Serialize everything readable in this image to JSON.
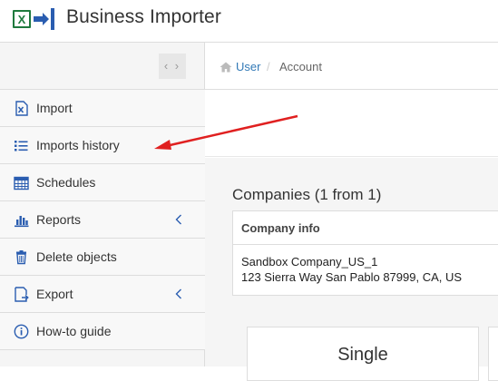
{
  "app": {
    "title": "Business Importer",
    "logo_icon": "excel-import-logo-icon"
  },
  "sidebar": {
    "collapse_toggle": "‹ ›",
    "items": [
      {
        "label": "Import",
        "icon": "excel-file-icon",
        "has_chevron": false
      },
      {
        "label": "Imports history",
        "icon": "list-icon",
        "has_chevron": false
      },
      {
        "label": "Schedules",
        "icon": "calendar-icon",
        "has_chevron": false
      },
      {
        "label": "Reports",
        "icon": "bar-chart-icon",
        "has_chevron": true
      },
      {
        "label": "Delete objects",
        "icon": "trash-icon",
        "has_chevron": false
      },
      {
        "label": "Export",
        "icon": "export-icon",
        "has_chevron": true
      },
      {
        "label": "How-to guide",
        "icon": "info-icon",
        "has_chevron": false
      }
    ]
  },
  "breadcrumb": {
    "home": "User",
    "separator": "/",
    "current": "Account"
  },
  "companies": {
    "title": "Companies (1 from 1)",
    "column_header": "Company info",
    "rows": [
      {
        "name": "Sandbox Company_US_1",
        "address": "123 Sierra Way San Pablo 87999, CA, US"
      }
    ]
  },
  "plans": {
    "card_title": "Single"
  },
  "colors": {
    "link": "#337ab7",
    "annotation_arrow": "#e02020",
    "excel_green": "#1f7a3e",
    "icon_blue": "#2a5db0"
  }
}
